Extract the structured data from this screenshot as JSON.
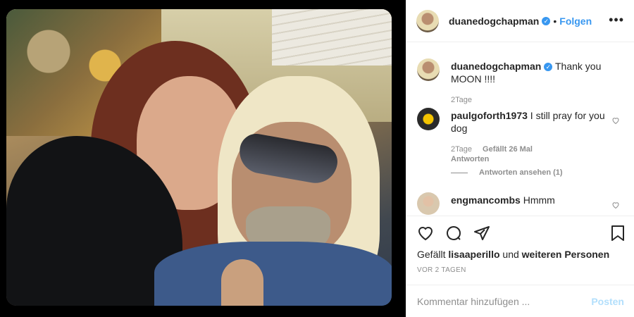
{
  "post": {
    "author": "duanedogchapman",
    "author_verified": true,
    "separator": "•",
    "follow_label": "Folgen",
    "more_label": "•••"
  },
  "caption": {
    "author": "duanedogchapman",
    "text": "Thank you MOON !!!!",
    "time": "2Tage"
  },
  "comments": [
    {
      "author": "paulgoforth1973",
      "text": "I still pray for you dog",
      "time": "2Tage",
      "likes": "Gefällt 26 Mal",
      "reply_label": "Antworten",
      "view_replies": "Antworten ansehen (1)"
    },
    {
      "author": "engmancombs",
      "text": "Hmmm"
    }
  ],
  "actions": {
    "liked_by_prefix": "Gefällt",
    "liked_by_user": "lisaaperillo",
    "liked_by_middle": "und",
    "liked_by_suffix": "weiteren Personen",
    "date": "VOR 2 TAGEN"
  },
  "compose": {
    "placeholder": "Kommentar hinzufügen ...",
    "post_label": "Posten"
  },
  "icons": {
    "heart": "heart-icon",
    "comment": "comment-icon",
    "share": "share-icon",
    "bookmark": "bookmark-icon",
    "verified": "verified-badge-icon"
  },
  "colors": {
    "accent": "#3897f0",
    "muted": "#8e8e8e",
    "post_disabled": "#b2dffc"
  }
}
